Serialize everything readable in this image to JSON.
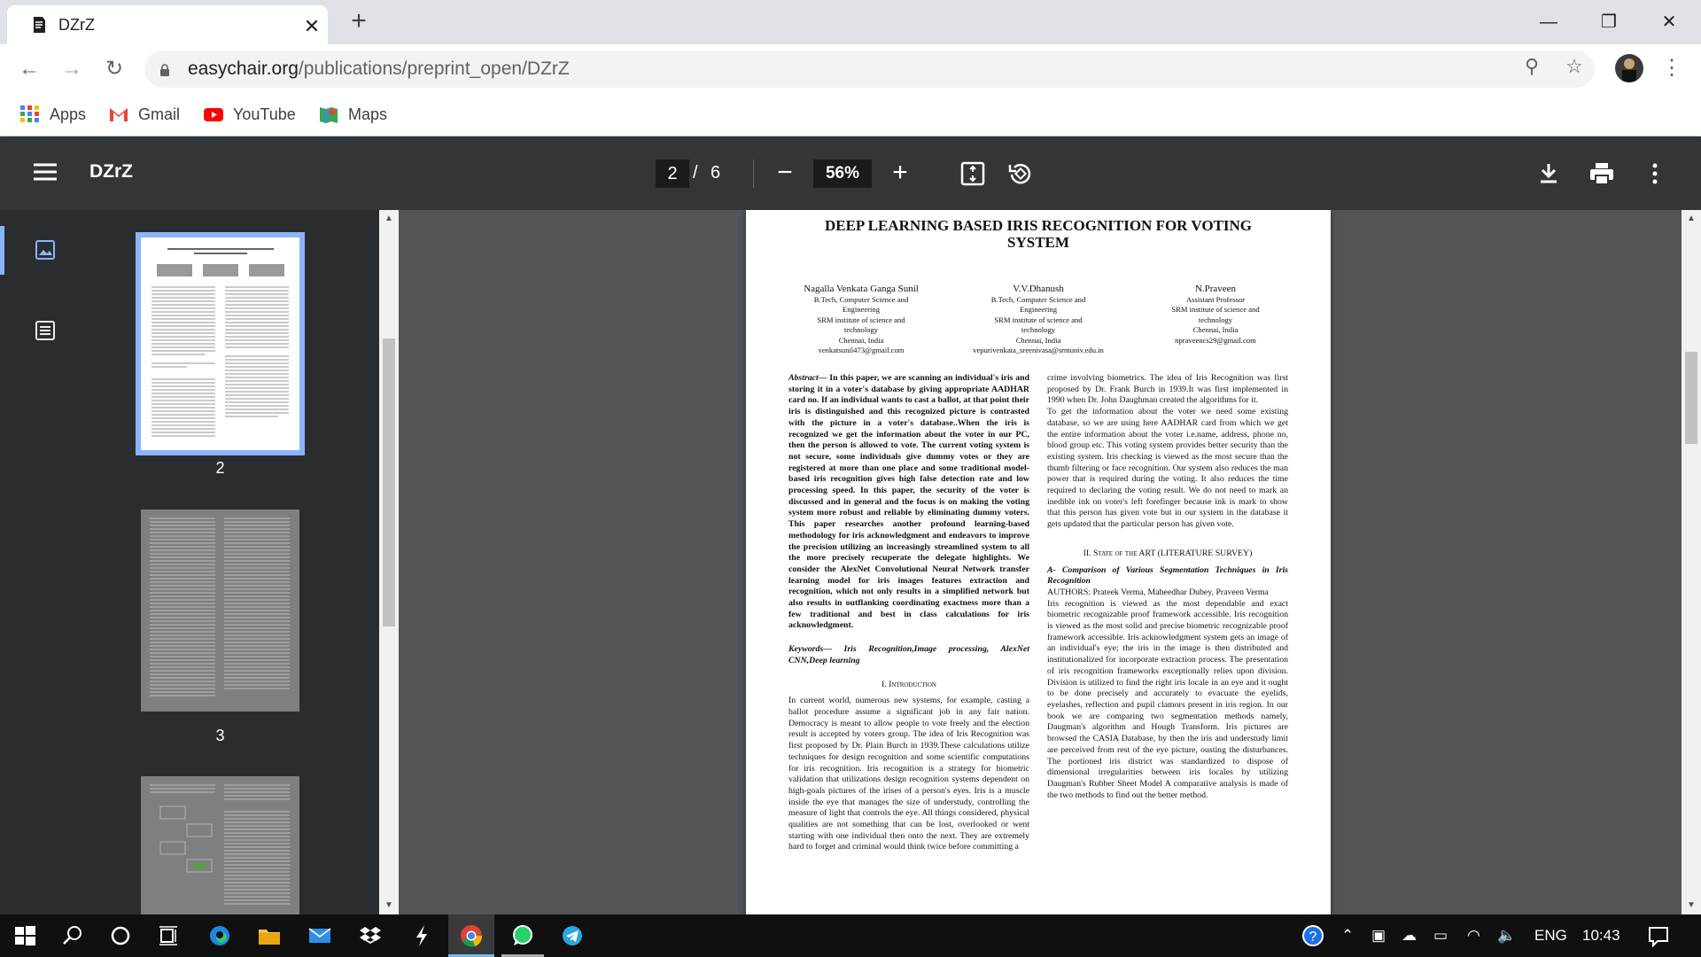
{
  "browser": {
    "tab_title": "DZrZ",
    "url_host": "easychair.org",
    "url_path": "/publications/preprint_open/DZrZ",
    "bookmarks": [
      {
        "label": "Apps",
        "icon": "apps-grid-icon"
      },
      {
        "label": "Gmail",
        "icon": "gmail-icon"
      },
      {
        "label": "YouTube",
        "icon": "youtube-icon"
      },
      {
        "label": "Maps",
        "icon": "maps-icon"
      }
    ]
  },
  "viewer": {
    "doc_title": "DZrZ",
    "current_page": "2",
    "page_sep": "/",
    "total_pages": "6",
    "zoom": "56%"
  },
  "thumbnails": [
    {
      "label": "2",
      "selected": true
    },
    {
      "label": "3",
      "selected": false
    }
  ],
  "paper": {
    "title_line1": "DEEP LEARNING BASED IRIS RECOGNITION FOR VOTING",
    "title_line2": "SYSTEM",
    "authors": [
      {
        "name": "Nagalla Venkata Ganga Sunil",
        "l1": "B.Tech, Computer Science and",
        "l2": "Engineering",
        "l3": "SRM institute of science and",
        "l4": "technology",
        "l5": "Chennai, India",
        "l6": "venkatsunil473@gmail.com"
      },
      {
        "name": "V.V.Dhanush",
        "l1": "B.Tech, Computer Science and",
        "l2": "Engineering",
        "l3": "SRM institute of science and",
        "l4": "technology",
        "l5": "Chennai, India",
        "l6": "vepurivenkata_sreenivasa@srmuniv.edu.in"
      },
      {
        "name": "N.Praveen",
        "l1": "Assistant Professor",
        "l2": "SRM institute of science and",
        "l3": "technology",
        "l4": "Chennai, India",
        "l5": "npraveencs29@gmail.com",
        "l6": ""
      }
    ],
    "abstract_head": "Abstract—",
    "abstract": "In this paper, we are scanning an individual's iris and storing it in a voter's database by giving appropriate AADHAR card no. If an individual wants to cast a ballot, at that point their iris is distinguished and this recognized picture is contrasted with the picture in a voter's database..When the iris is recognized we get the information about the voter in our PC, then the person is allowed to vote. The current voting system is not secure, some individuals give dummy votes or they are registered at more than one place and some traditional model-based iris recognition gives high false detection rate and low processing speed. In this paper, the security of the voter is discussed and in general and the focus is on making the voting system more robust and reliable by eliminating dummy voters. This paper researches another profound learning-based methodology for iris acknowledgment and endeavors to improve the precision utilizing an increasingly streamlined system to all the more precisely recuperate the delegate highlights. We consider the AlexNet Convolutional Neural Network transfer learning model for iris images features extraction and recognition, which not only results in a simplified network but also results in outflanking coordinating exactness more than a few traditional and best in class calculations for iris acknowledgment.",
    "keywords_head": "Keywords—",
    "keywords": "Iris Recognition,Image processing, AlexNet CNN,Deep learning",
    "intro_heading": "I.     Introduction",
    "intro": "In current world, numerous new systems, for example, casting a ballot procedure assume a significant job in any fair nation. Democracy is meant to allow people to vote freely and the election result is accepted by voters group. The idea of Iris Recognition was first proposed by Dr. Plain Burch in 1939.These calculations utilize techniques for design recognition and some scientific computations for iris recognition. Iris recognition is a strategy for biometric validation that utilizations design recognition systems dependent on high-goals pictures of the irises of a person's eyes. Iris is a muscle inside the eye that manages the size of understudy, controlling the measure of light that controls the eye. All things considered, physical qualities are not something that can be lost, overlooked or went starting with one individual then onto the next. They are extremely hard to forget and criminal would think twice before committing a",
    "right_p1": "crime involving biometrics. The idea of Iris Recognition was first proposed by Dr. Frank Burch in 1939.It was first implemented in 1990 when Dr. John Daughman created the algorithms for it.",
    "right_p2": "To get the information about the voter we need some existing database, so we are using here AADHAR card from which we get the entire information about the voter i.e.name, address, phone no, blood group etc. This voting system provides better security than the existing system. Iris checking is viewed as the most secure than the thumb filtering or face recognition. Our system also reduces the man power that is required during the voting. It also reduces the time required to declaring the voting result. We do not need to mark an inedible ink on voter's left forefinger because ink is mark to show that this person has given vote but in our system in the database it gets updated that the particular person has given vote.",
    "sec2_heading": "II.     State of the ART (LITERATURE SURVEY)",
    "sec2_sub": "A- Comparison of Various Segmentation Techniques in Iris Recognition",
    "sec2_authors": "AUTHORS: Prateek Verma, Maheedhar Dubey, Praveen Verma",
    "sec2_body": "Iris recognition is viewed as the most dependable and exact biometric recognizable proof framework accessible. Iris recognition is viewed as the most solid and precise biometric recognizable proof framework accessible. Iris acknowledgment system gets an image of an individual's eye; the iris in the image is then distributed and institutionalized for incorporate extraction process. The presentation of iris recognition frameworks exceptionally relies upon division. Division is utilized to find the right iris locale in an eye and it ought to be done precisely and accurately to evacuate the eyelids, eyelashes, reflection and pupil clamors present in iris region. In our book we are comparing two segmentation methods namely, Daugman's algorithm and Hough Transform. Iris pictures are browsed the CASIA Database, by then the iris and understudy limit are perceived from rest of the eye picture, ousting the disturbances. The portioned iris district was standardized to dispose of dimensional irregularities between iris locales by utilizing Daugman's Rubber Sheet Model A comparative analysis is made of the two methods to find out the better method."
  },
  "taskbar": {
    "lang": "ENG",
    "time": "10:43"
  }
}
